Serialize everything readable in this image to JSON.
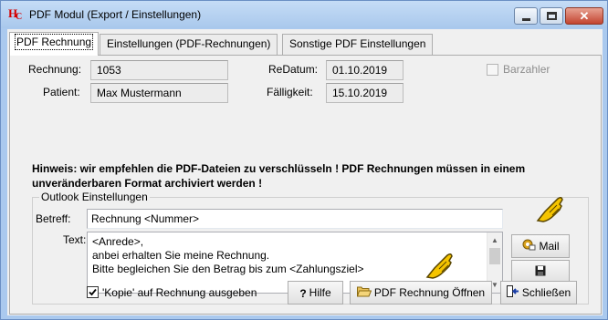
{
  "window": {
    "icon_letters": {
      "h": "H",
      "c": "C"
    },
    "title": "PDF Modul (Export / Einstellungen)",
    "controls": {
      "minimize": "minimize-icon",
      "maximize": "maximize-icon",
      "close": "✕"
    }
  },
  "tabs": [
    {
      "label": "PDF Rechnung",
      "active": true
    },
    {
      "label": "Einstellungen (PDF-Rechnungen)",
      "active": false
    },
    {
      "label": "Sonstige PDF Einstellungen",
      "active": false
    }
  ],
  "invoice": {
    "rechnung_label": "Rechnung:",
    "rechnung_value": "1053",
    "patient_label": "Patient:",
    "patient_value": "Max Mustermann",
    "redatum_label": "ReDatum:",
    "redatum_value": "01.10.2019",
    "faelligkeit_label": "Fälligkeit:",
    "faelligkeit_value": "15.10.2019",
    "barzahler_label": "Barzahler",
    "barzahler_checked": false
  },
  "hint": {
    "line1": "Hinweis: wir empfehlen die PDF-Dateien zu verschlüsseln ! PDF Rechnungen müssen in einem",
    "line2": "unveränderbaren Format archiviert werden !"
  },
  "outlook": {
    "group_title": "Outlook Einstellungen",
    "betreff_label": "Betreff:",
    "betreff_value": "Rechnung <Nummer>",
    "text_label": "Text:",
    "text_lines": [
      "<Anrede>,",
      "anbei erhalten Sie meine Rechnung.",
      "Bitte begleichen Sie den Betrag bis zum <Zahlungsziel>"
    ],
    "mail_button": "Mail",
    "save_icon": "floppy-disk-icon"
  },
  "footer": {
    "kopie_label": "'Kopie' auf Rechnung ausgeben",
    "kopie_checked": true,
    "hilfe_button": "Hilfe",
    "open_pdf_button": "PDF Rechnung Öffnen",
    "close_button": "Schließen"
  },
  "colors": {
    "title_bar": "#aac9ee",
    "close_button": "#c34430",
    "pointer_hand": "#f5c400"
  }
}
